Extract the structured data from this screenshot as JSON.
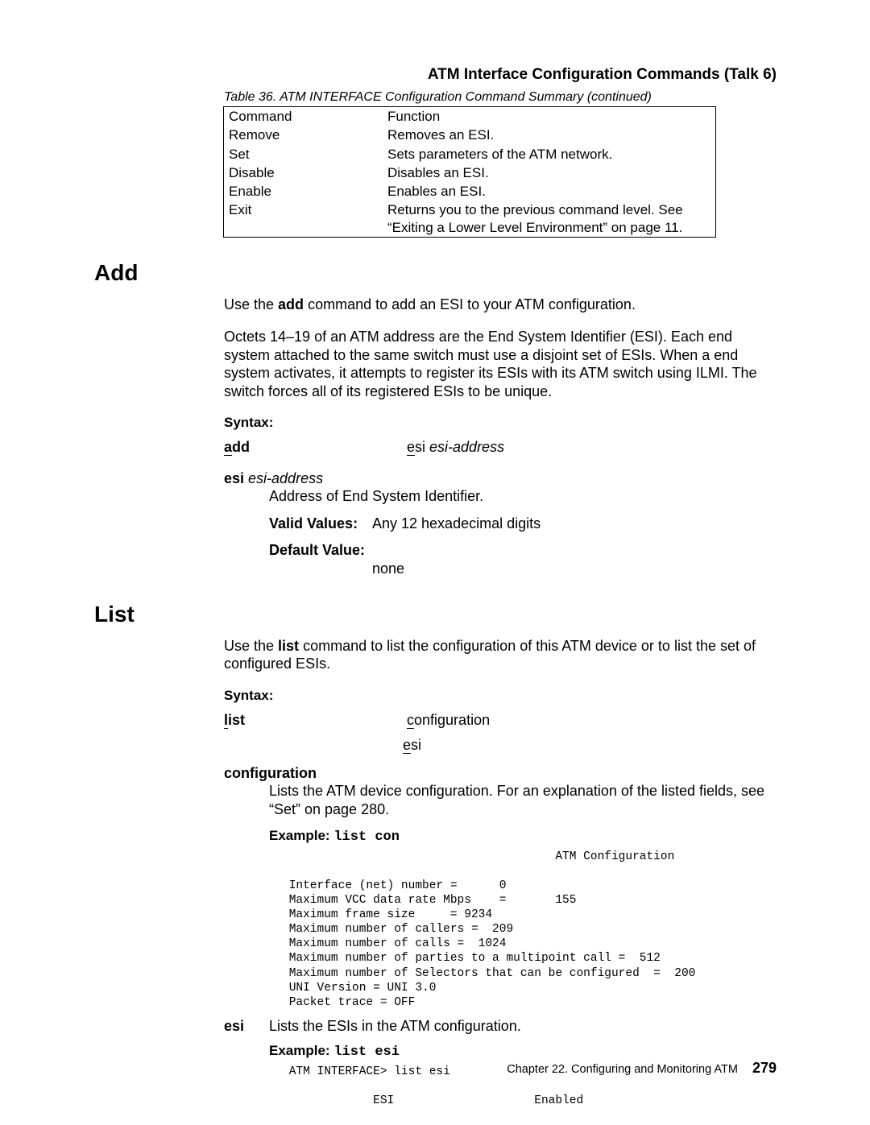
{
  "running_head": "ATM Interface Configuration Commands (Talk 6)",
  "table": {
    "caption": "Table 36. ATM INTERFACE Configuration Command Summary  (continued)",
    "rows": [
      {
        "cmd": "Command",
        "fn": "Function"
      },
      {
        "cmd": "Remove",
        "fn": "Removes an ESI."
      },
      {
        "cmd": "Set",
        "fn": "Sets parameters of the ATM network."
      },
      {
        "cmd": "Disable",
        "fn": "Disables an ESI."
      },
      {
        "cmd": "Enable",
        "fn": "Enables an ESI."
      },
      {
        "cmd": "Exit",
        "fn": "Returns you to the previous command level. See “Exiting a Lower Level Environment” on page 11."
      }
    ]
  },
  "sections": {
    "add": {
      "title": "Add",
      "p1_a": "Use the ",
      "p1_b": "add",
      "p1_c": " command to add an ESI to your ATM configuration.",
      "p2": "Octets 14–19 of an ATM address are the End System Identifier (ESI). Each end system attached to the same switch must use a disjoint set of ESIs. When a end system activates, it attempts to register its ESIs with its ATM switch using ILMI. The switch forces all of its registered ESIs to be unique.",
      "syntax_label": "Syntax:",
      "cmd_first": "a",
      "cmd_rest": "dd",
      "arg_u": "e",
      "arg_plain": "si ",
      "arg_ital": "esi-address",
      "term_bold": "esi",
      "term_ital": " esi-address",
      "desc": "Address of End System Identifier.",
      "valid_label": "Valid Values:",
      "valid_value": "Any 12 hexadecimal digits",
      "default_label": "Default Value:",
      "default_value": "none"
    },
    "list": {
      "title": "List",
      "p1_a": "Use the ",
      "p1_b": "list",
      "p1_c": " command to list the configuration of this ATM device or to list the set of configured ESIs.",
      "syntax_label": "Syntax:",
      "cmd_first": "l",
      "cmd_rest": "ist",
      "opt1_u": "c",
      "opt1_rest": "onfiguration",
      "opt2_u": "e",
      "opt2_rest": "si",
      "cfg_term": "configuration",
      "cfg_desc": "Lists the ATM device configuration. For an explanation of the listed fields, see “Set” on page 280.",
      "example_label": "Example:",
      "example_cmd1": "list con",
      "console1": "                                       ATM Configuration\n\n Interface (net) number =      0\n Maximum VCC data rate Mbps    =       155\n Maximum frame size     = 9234\n Maximum number of callers =  209\n Maximum number of calls =  1024\n Maximum number of parties to a multipoint call =  512\n Maximum number of Selectors that can be configured  =  200\n UNI Version = UNI 3.0\n Packet trace = OFF",
      "esi_term": "esi",
      "esi_desc": "Lists the ESIs in the ATM configuration.",
      "example_cmd2": "list esi",
      "console2": " ATM INTERFACE> list esi\n\n             ESI                    Enabled"
    }
  },
  "footer": {
    "chapter": "Chapter 22. Configuring and Monitoring ATM",
    "page": "279"
  }
}
